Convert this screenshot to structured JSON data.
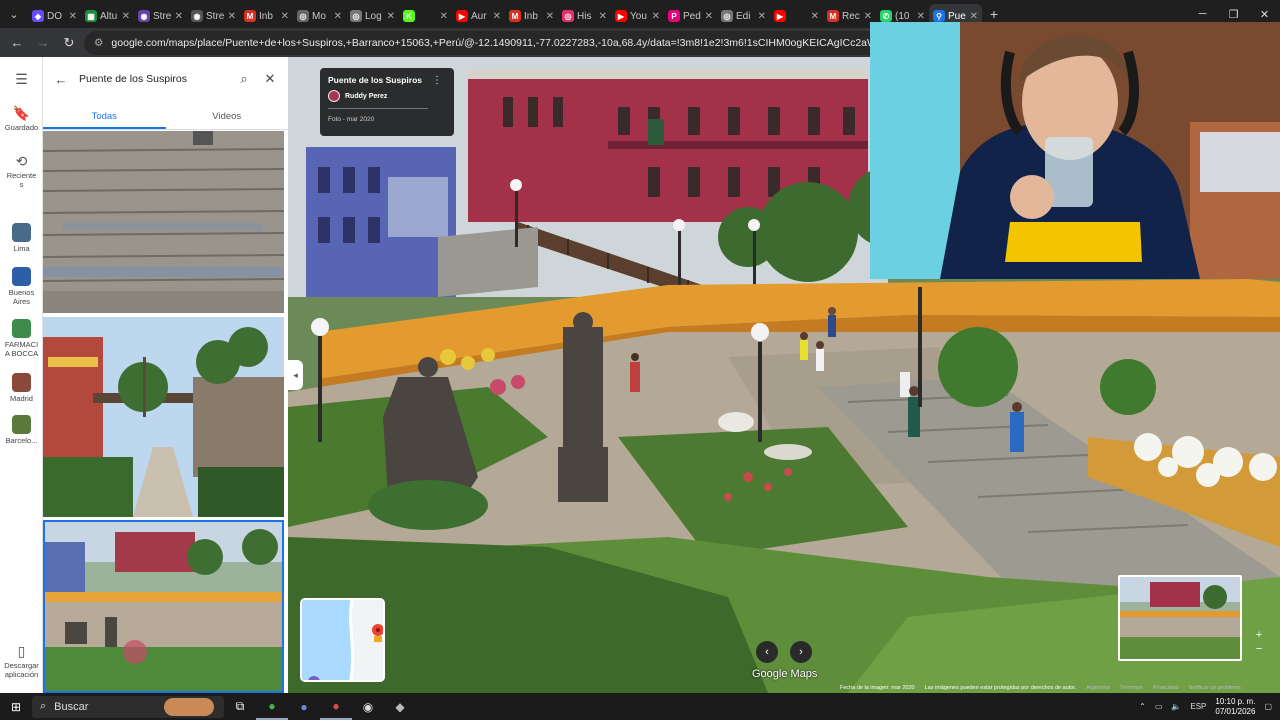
{
  "browser": {
    "tabs": [
      {
        "label": "DO",
        "icon": "game-icon",
        "color": "#6a4cff"
      },
      {
        "label": "Altu",
        "icon": "sheets-icon",
        "color": "#1e8e3e"
      },
      {
        "label": "Stre",
        "icon": "stream-icon",
        "color": "#6441a5"
      },
      {
        "label": "Stre",
        "icon": "stream-icon",
        "color": "#555555"
      },
      {
        "label": "Inb",
        "icon": "gmail-icon",
        "color": "#d93025"
      },
      {
        "label": "Mo",
        "icon": "globe-icon",
        "color": "#666666"
      },
      {
        "label": "Log",
        "icon": "globe-icon",
        "color": "#777777"
      },
      {
        "label": "",
        "icon": "kick-icon",
        "color": "#53fc18"
      },
      {
        "label": "Aur",
        "icon": "youtube-icon",
        "color": "#ff0000"
      },
      {
        "label": "Inb",
        "icon": "gmail-icon",
        "color": "#d93025"
      },
      {
        "label": "His",
        "icon": "instagram-icon",
        "color": "#e1306c"
      },
      {
        "label": "You",
        "icon": "youtube-icon",
        "color": "#ff0000"
      },
      {
        "label": "Ped",
        "icon": "pedidos-icon",
        "color": "#e6007e"
      },
      {
        "label": "Edi",
        "icon": "globe-icon",
        "color": "#777777"
      },
      {
        "label": "",
        "icon": "youtube-icon",
        "color": "#ff0000"
      },
      {
        "label": "Rec",
        "icon": "gmail-icon",
        "color": "#d93025"
      },
      {
        "label": "(10",
        "icon": "whatsapp-icon",
        "color": "#25d366"
      },
      {
        "label": "Pue",
        "icon": "maps-icon",
        "color": "#1a73e8",
        "active": true
      }
    ],
    "new_tab": "+",
    "url": "google.com/maps/place/Puente+de+los+Suspiros,+Barranco+15063,+Perú/@-12.1490911,-77.0227283,-10a,68.4y/data=!3m8!1e2!3m6!1sCIHM0ogKEICAgICc2aWp7AE!2e10!3e12!6shttp"
  },
  "rail": {
    "saved": "Guardado",
    "recent": "Reciente\ns",
    "places": [
      {
        "label": "Lima",
        "color": "#4a6a8a"
      },
      {
        "label": "Buenos\nAires",
        "color": "#2d5fa8"
      },
      {
        "label": "FARMACI\nA BOCCA",
        "color": "#3d8a4a"
      },
      {
        "label": "Madrid",
        "color": "#8a4a3a"
      },
      {
        "label": "Barcelo...",
        "color": "#5a7a3a"
      }
    ],
    "download": "Descargar\naplicación"
  },
  "panel": {
    "query": "Puente de los Suspiros",
    "tabs": [
      "Todas",
      "Videos"
    ],
    "selected_tab": "Todas"
  },
  "viewer": {
    "photo_title": "Puente de los Suspiros",
    "author": "Ruddy Perez",
    "date": "Foto - mar 2020",
    "brand": "Google Maps",
    "footer": {
      "image_date": "Fecha de la imagen: mar 2020",
      "copyright": "Las imágenes pueden estar protegidas por derechos de autor.",
      "country": "Argentina",
      "terms": "Términos",
      "privacy": "Privacidad",
      "report": "Notificar un problema"
    }
  },
  "taskbar": {
    "search_label": "Buscar",
    "language": "ESP",
    "time": "10:10 p. m.",
    "date": "07/01/2026"
  }
}
